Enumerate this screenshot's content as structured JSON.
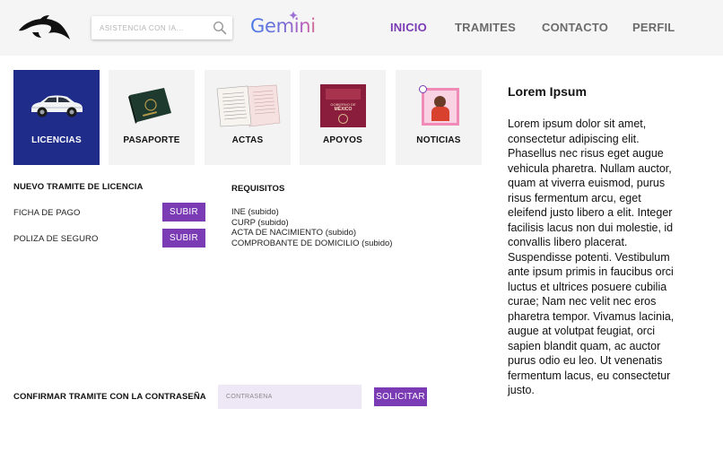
{
  "header": {
    "search_placeholder": "ASISTENCIA CON IA...",
    "gemini_label": "Gemini",
    "nav": [
      {
        "label": "INICIO",
        "active": true
      },
      {
        "label": "TRAMITES",
        "active": false
      },
      {
        "label": "CONTACTO",
        "active": false
      },
      {
        "label": "PERFIL",
        "active": false
      }
    ]
  },
  "tiles": [
    {
      "label": "LICENCIAS",
      "icon": "car-icon",
      "active": true
    },
    {
      "label": "PASAPORTE",
      "icon": "passport-icon",
      "active": false
    },
    {
      "label": "ACTAS",
      "icon": "documents-icon",
      "active": false
    },
    {
      "label": "APOYOS",
      "icon": "government-poster-icon",
      "active": false
    },
    {
      "label": "NOTICIAS",
      "icon": "news-image-icon",
      "active": false
    }
  ],
  "tiles_poster_text": [
    "GOBIERNO DE",
    "MÉXICO"
  ],
  "license_form": {
    "title": "NUEVO TRAMITE DE LICENCIA",
    "rows": [
      {
        "label": "FICHA DE PAGO",
        "button": "SUBIR"
      },
      {
        "label": "POLIZA DE SEGURO",
        "button": "SUBIR"
      }
    ]
  },
  "requirements": {
    "title": "REQUISITOS",
    "items": [
      "INE (subido)",
      "CURP (subido)",
      "ACTA DE NACIMIENTO (subido)",
      "COMPROBANTE DE DOMICILIO (subido)"
    ]
  },
  "confirm": {
    "label": "CONFIRMAR TRAMITE CON LA CONTRASEÑA",
    "password_placeholder": "CONTRASEÑA",
    "submit_label": "SOLICITAR"
  },
  "sidebar": {
    "title": "Lorem Ipsum",
    "paragraphs": [
      "Lorem ipsum dolor sit amet, consectetur adipiscing elit. Phasellus nec risus eget augue vehicula pharetra. Nullam auctor, quam at viverra euismod, purus risus fermentum arcu, eget eleifend justo libero a elit. Integer facilisis lacus non dui molestie, id convallis libero placerat.",
      "Suspendisse potenti. Vestibulum ante ipsum primis in faucibus orci luctus et ultrices posuere cubilia curae; Nam nec velit nec eros pharetra tempor. Vivamus lacinia, augue at volutpat feugiat, orci sapien blandit quam, ac auctor purus odio eu leo. Ut venenatis fermentum lacus, eu consectetur justo."
    ]
  },
  "colors": {
    "accent_purple": "#7a3bb5",
    "active_tile": "#1f2c8a",
    "header_bg": "#f5f5f5"
  }
}
